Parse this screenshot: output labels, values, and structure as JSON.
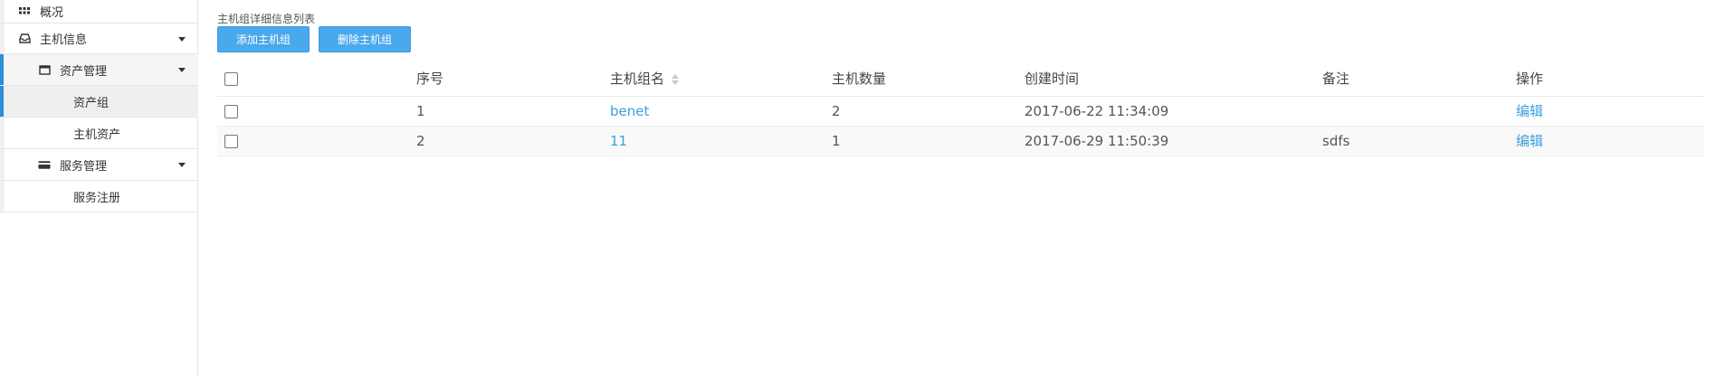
{
  "sidebar": {
    "items": [
      {
        "label": "概况",
        "icon": "grid-icon"
      },
      {
        "label": "主机信息",
        "icon": "inbox-icon"
      },
      {
        "label": "资产管理",
        "icon": "window-icon"
      },
      {
        "label": "资产组"
      },
      {
        "label": "主机资产"
      },
      {
        "label": "服务管理",
        "icon": "card-icon"
      },
      {
        "label": "服务注册"
      }
    ]
  },
  "main": {
    "list_title": "主机组详细信息列表",
    "add_button": "添加主机组",
    "delete_button": "删除主机组"
  },
  "table": {
    "headers": [
      "序号",
      "主机组名",
      "主机数量",
      "创建时间",
      "备注",
      "操作"
    ],
    "rows": [
      {
        "index": "1",
        "name": "benet",
        "count": "2",
        "created": "2017-06-22 11:34:09",
        "note": "",
        "action": "编辑"
      },
      {
        "index": "2",
        "name": "11",
        "count": "1",
        "created": "2017-06-29 11:50:39",
        "note": "sdfs",
        "action": "编辑"
      }
    ]
  },
  "colors": {
    "accent": "#4aa8ec",
    "link": "#3a9fe0",
    "active_bar": "#2b8ed6"
  }
}
